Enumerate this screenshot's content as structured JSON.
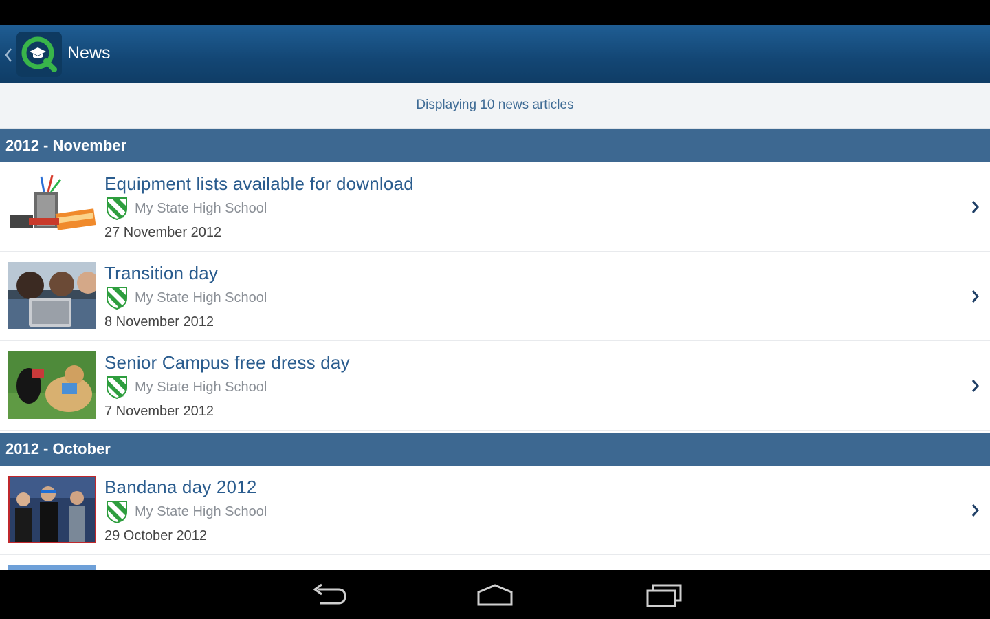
{
  "action_bar": {
    "title": "News",
    "up_icon": "chevron-left-icon",
    "logo_icon": "graduation-cap-search-logo"
  },
  "info": {
    "text": "Displaying 10 news articles"
  },
  "sections": [
    {
      "header": "2012 - November",
      "items": [
        {
          "title": "Equipment lists available for download",
          "school": "My State High School",
          "date": "27 November 2012",
          "thumb": "stationery-image"
        },
        {
          "title": "Transition day",
          "school": "My State High School",
          "date": "8 November 2012",
          "thumb": "students-tablet-image"
        },
        {
          "title": "Senior Campus free dress day",
          "school": "My State High School",
          "date": "7 November 2012",
          "thumb": "dogs-image"
        }
      ]
    },
    {
      "header": "2012 - October",
      "items": [
        {
          "title": "Bandana day 2012",
          "school": "My State High School",
          "date": "29 October 2012",
          "thumb": "bandana-group-image"
        }
      ]
    }
  ],
  "colors": {
    "action_bar": "#134674",
    "section_header": "#3d6891",
    "title_text": "#2a5c8e",
    "shield_green": "#2e9e3e"
  },
  "nav": {
    "back_icon": "back-arrow-icon",
    "home_icon": "home-icon",
    "recents_icon": "recent-apps-icon"
  }
}
